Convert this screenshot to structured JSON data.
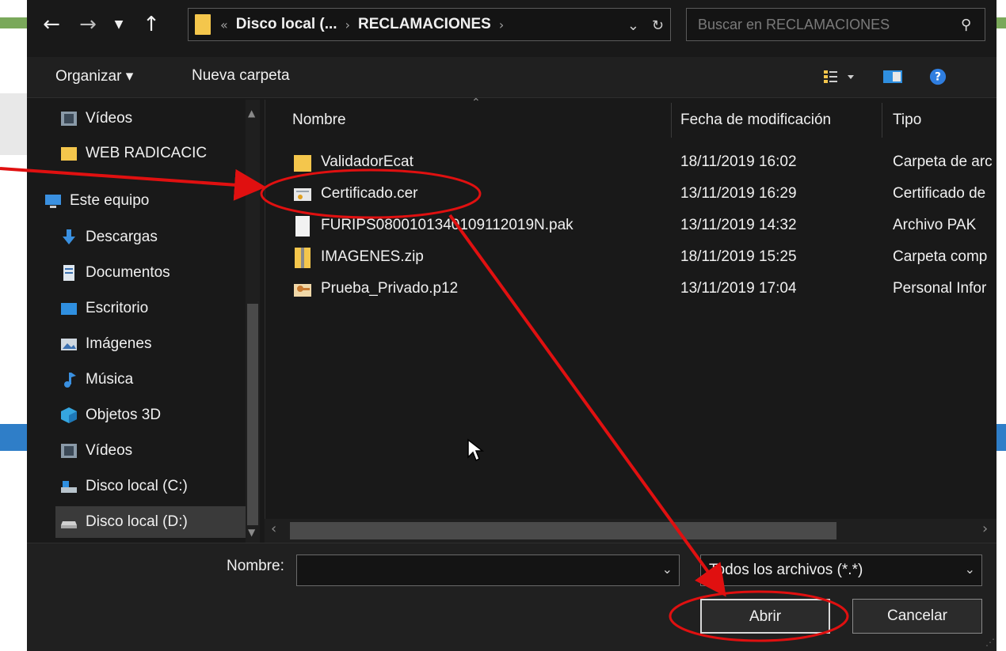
{
  "window": {
    "breadcrumb": [
      "Disco local (...",
      "RECLAMACIONES"
    ],
    "search_placeholder": "Buscar en RECLAMACIONES"
  },
  "toolbar": {
    "organize_label": "Organizar ▾",
    "new_folder_label": "Nueva carpeta"
  },
  "sidebar": {
    "items": [
      {
        "label": "Vídeos",
        "icon": "video-icon"
      },
      {
        "label": "WEB RADICACIC",
        "icon": "folder-icon"
      },
      {
        "label": "Este equipo",
        "icon": "computer-icon"
      },
      {
        "label": "Descargas",
        "icon": "download-icon"
      },
      {
        "label": "Documentos",
        "icon": "document-icon"
      },
      {
        "label": "Escritorio",
        "icon": "desktop-icon"
      },
      {
        "label": "Imágenes",
        "icon": "pictures-icon"
      },
      {
        "label": "Música",
        "icon": "music-icon"
      },
      {
        "label": "Objetos 3D",
        "icon": "3d-objects-icon"
      },
      {
        "label": "Vídeos",
        "icon": "video-icon"
      },
      {
        "label": "Disco local (C:)",
        "icon": "drive-icon"
      },
      {
        "label": "Disco local (D:)",
        "icon": "drive-icon"
      }
    ]
  },
  "file_list": {
    "columns": [
      "Nombre",
      "Fecha de modificación",
      "Tipo"
    ],
    "rows": [
      {
        "name": "ValidadorEcat",
        "date": "18/11/2019 16:02",
        "type": "Carpeta de arc",
        "icon": "folder-icon"
      },
      {
        "name": "Certificado.cer",
        "date": "13/11/2019 16:29",
        "type": "Certificado de",
        "icon": "certificate-icon"
      },
      {
        "name": "FURIPS080010134010911​2019N.pak",
        "date": "13/11/2019 14:32",
        "type": "Archivo PAK",
        "icon": "file-icon"
      },
      {
        "name": "IMAGENES.zip",
        "date": "18/11/2019 15:25",
        "type": "Carpeta comp",
        "icon": "zip-icon"
      },
      {
        "name": "Prueba_Privado.p12",
        "date": "13/11/2019 17:04",
        "type": "Personal Infor",
        "icon": "p12-icon"
      }
    ]
  },
  "bottom": {
    "name_label": "Nombre:",
    "name_value": "",
    "file_type": "Todos los archivos (*.*)",
    "open_label": "Abrir",
    "cancel_label": "Cancelar"
  },
  "colors": {
    "annotation": "#e01010",
    "folder": "#f4c64c",
    "dialog_bg": "#191919"
  }
}
